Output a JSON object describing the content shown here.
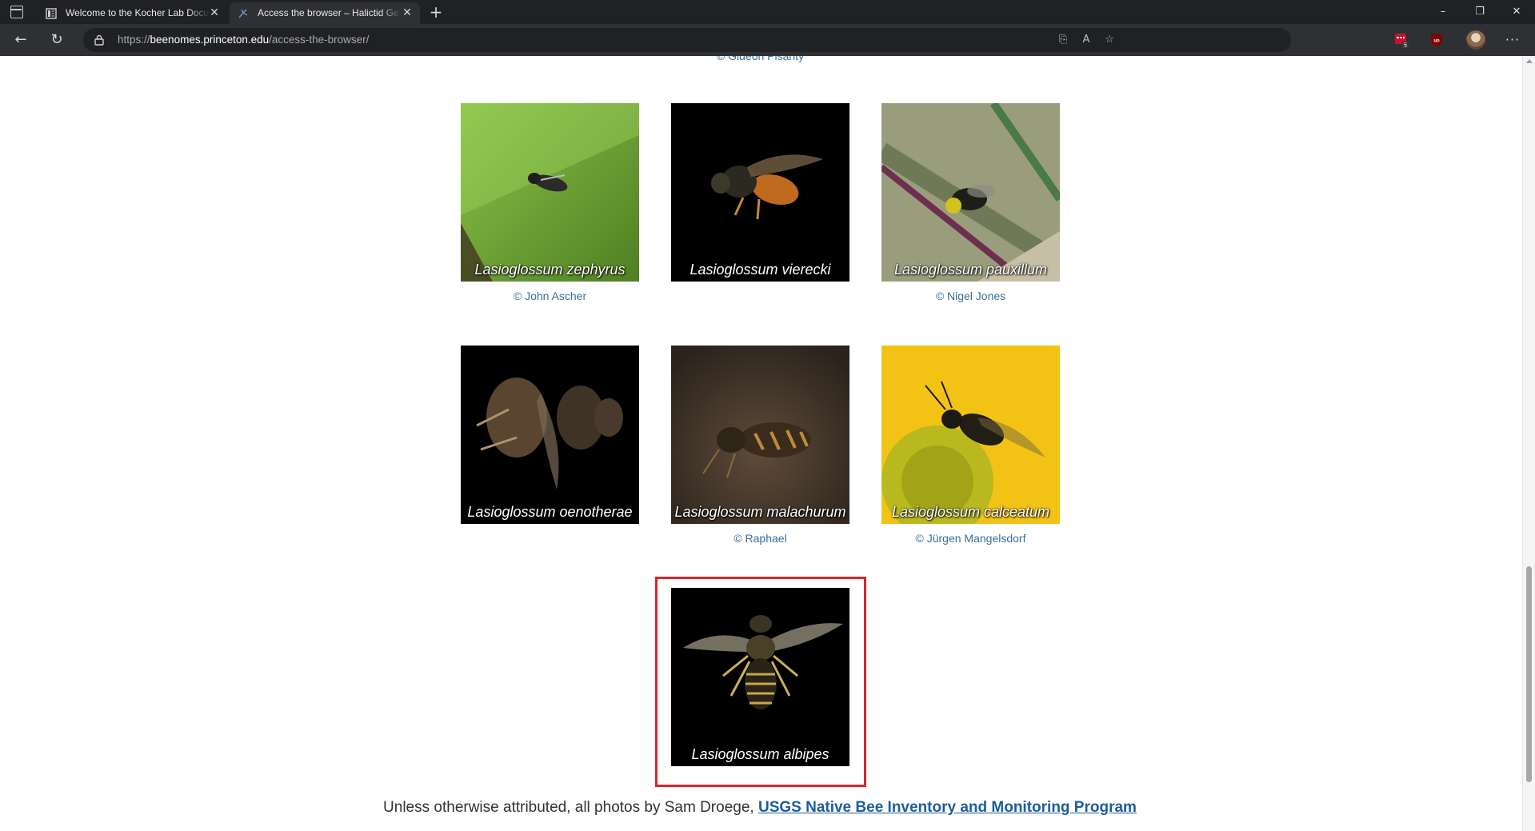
{
  "browser": {
    "tabs": [
      {
        "title": "Welcome to the Kocher Lab Docu",
        "active": false
      },
      {
        "title": "Access the browser – Halictid Ge",
        "active": true
      }
    ],
    "new_tab_label": "+",
    "url_scheme": "https://",
    "url_host": "beenomes.princeton.edu",
    "url_path": "/access-the-browser/",
    "extension_badge": "5",
    "window_controls": {
      "minimize": "–",
      "maximize": "❐",
      "close": "✕"
    }
  },
  "page": {
    "top_credit_partial": "© Gideon Pisanty",
    "gallery_rows": [
      [
        {
          "species": "Lasioglossum zephyrus",
          "credit": "© John Ascher",
          "bg": "#6aa43a"
        },
        {
          "species": "Lasioglossum vierecki",
          "credit": "",
          "bg": "#000000"
        },
        {
          "species": "Lasioglossum pauxillum",
          "credit": "© Nigel Jones",
          "bg": "#8a8f6a"
        }
      ],
      [
        {
          "species": "Lasioglossum oenotherae",
          "credit": "",
          "bg": "#000000"
        },
        {
          "species": "Lasioglossum malachurum",
          "credit": "© Raphael",
          "bg": "#4a3a2c"
        },
        {
          "species": "Lasioglossum calceatum",
          "credit": "© Jürgen Mangelsdorf",
          "bg": "#f1c21a"
        }
      ],
      [
        {
          "species": "Lasioglossum albipes",
          "credit": "",
          "bg": "#000000"
        }
      ]
    ],
    "footer": {
      "prefix": "Unless otherwise attributed, all photos by Sam Droege,",
      "link_text": "USGS Native Bee Inventory and Monitoring Program"
    }
  },
  "colors": {
    "chrome_dark": "#202124",
    "toolbar": "#2f3033",
    "link": "#1d5e9a",
    "credit": "#3a6f95",
    "highlight": "#d7262b"
  }
}
